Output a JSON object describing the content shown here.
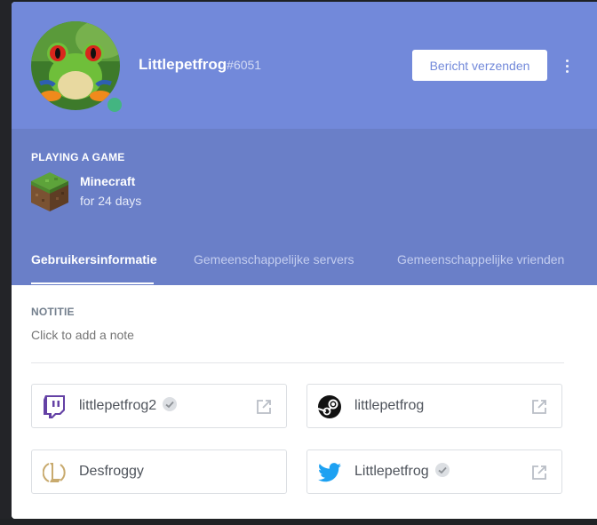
{
  "profile": {
    "username": "Littlepetfrog",
    "discriminator": "#6051",
    "status": "online",
    "send_message_label": "Bericht verzenden"
  },
  "activity": {
    "heading": "PLAYING A GAME",
    "game": "Minecraft",
    "duration": "for 24 days"
  },
  "tabs": [
    {
      "label": "Gebruikersinformatie",
      "active": true
    },
    {
      "label": "Gemeenschappelijke servers",
      "active": false
    },
    {
      "label": "Gemeenschappelijke vrienden",
      "active": false
    }
  ],
  "note": {
    "heading": "NOTITIE",
    "placeholder": "Click to add a note"
  },
  "accounts": [
    {
      "service": "twitch-icon",
      "name": "littlepetfrog2",
      "verified": true
    },
    {
      "service": "steam-icon",
      "name": "littlepetfrog",
      "verified": false
    },
    {
      "service": "league-of-legends-icon",
      "name": "Desfroggy",
      "verified": false
    },
    {
      "service": "twitter-icon",
      "name": "Littlepetfrog",
      "verified": true
    }
  ],
  "colors": {
    "blurple": "#7289da",
    "activity_bg": "#6a7fc8",
    "online": "#43b581",
    "twitch": "#6441a5",
    "twitter": "#1da1f2",
    "league": "#c8aa6e"
  }
}
